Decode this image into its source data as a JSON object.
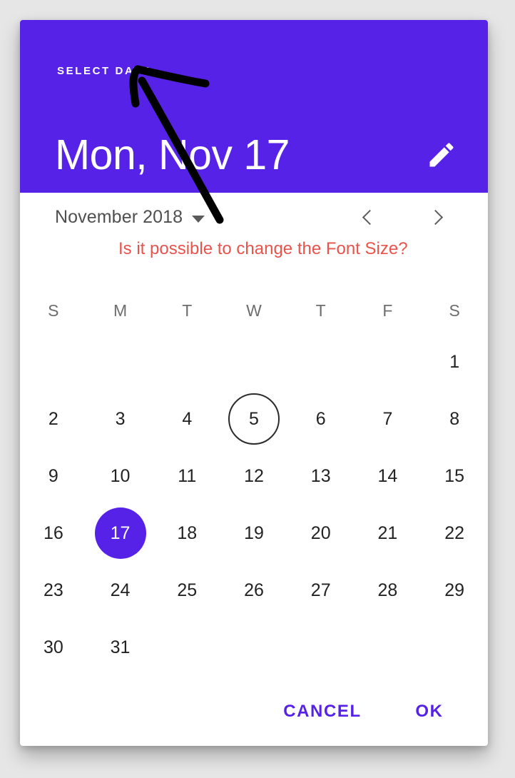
{
  "dialog": {
    "header": {
      "overline": "SELECT DATE",
      "date_title": "Mon, Nov 17",
      "edit_icon": "pencil-icon",
      "background_color": "#5722e8",
      "text_color": "#ffffff"
    },
    "month_nav": {
      "month_label": "November 2018",
      "dropdown_icon": "caret-down-icon",
      "prev_icon": "chevron-left-icon",
      "next_icon": "chevron-right-icon"
    },
    "weekdays": [
      "S",
      "M",
      "T",
      "W",
      "T",
      "F",
      "S"
    ],
    "calendar": {
      "leading_blanks": 6,
      "days": [
        1,
        2,
        3,
        4,
        5,
        6,
        7,
        8,
        9,
        10,
        11,
        12,
        13,
        14,
        15,
        16,
        17,
        18,
        19,
        20,
        21,
        22,
        23,
        24,
        25,
        26,
        27,
        28,
        29,
        30,
        31
      ],
      "today": 5,
      "selected": 17,
      "selected_color": "#5722e8",
      "today_outline_color": "#2b2b2b"
    },
    "actions": {
      "cancel_label": "CANCEL",
      "ok_label": "OK",
      "action_color": "#5722e8"
    }
  },
  "annotation": {
    "question_text": "Is it possible to change the Font Size?",
    "question_color": "#e8534c",
    "arrow_color": "#000000"
  },
  "page": {
    "background_color": "#e6e6e6"
  }
}
